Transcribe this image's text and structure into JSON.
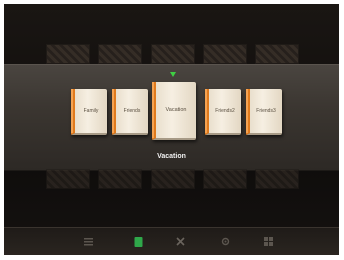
{
  "albums": [
    {
      "label": "Family"
    },
    {
      "label": "Friends"
    },
    {
      "label": "Vacation"
    },
    {
      "label": "Friends2"
    },
    {
      "label": "Friends3"
    }
  ],
  "selected_album": "Vacation",
  "toolbar": {
    "icons": [
      "list-icon",
      "album-icon",
      "close-icon",
      "settings-icon",
      "grid-icon"
    ]
  },
  "colors": {
    "album_spine": "#e07a1d",
    "selection_arrow": "#3fcf43",
    "active_toolbar_icon": "#2fa84a"
  }
}
